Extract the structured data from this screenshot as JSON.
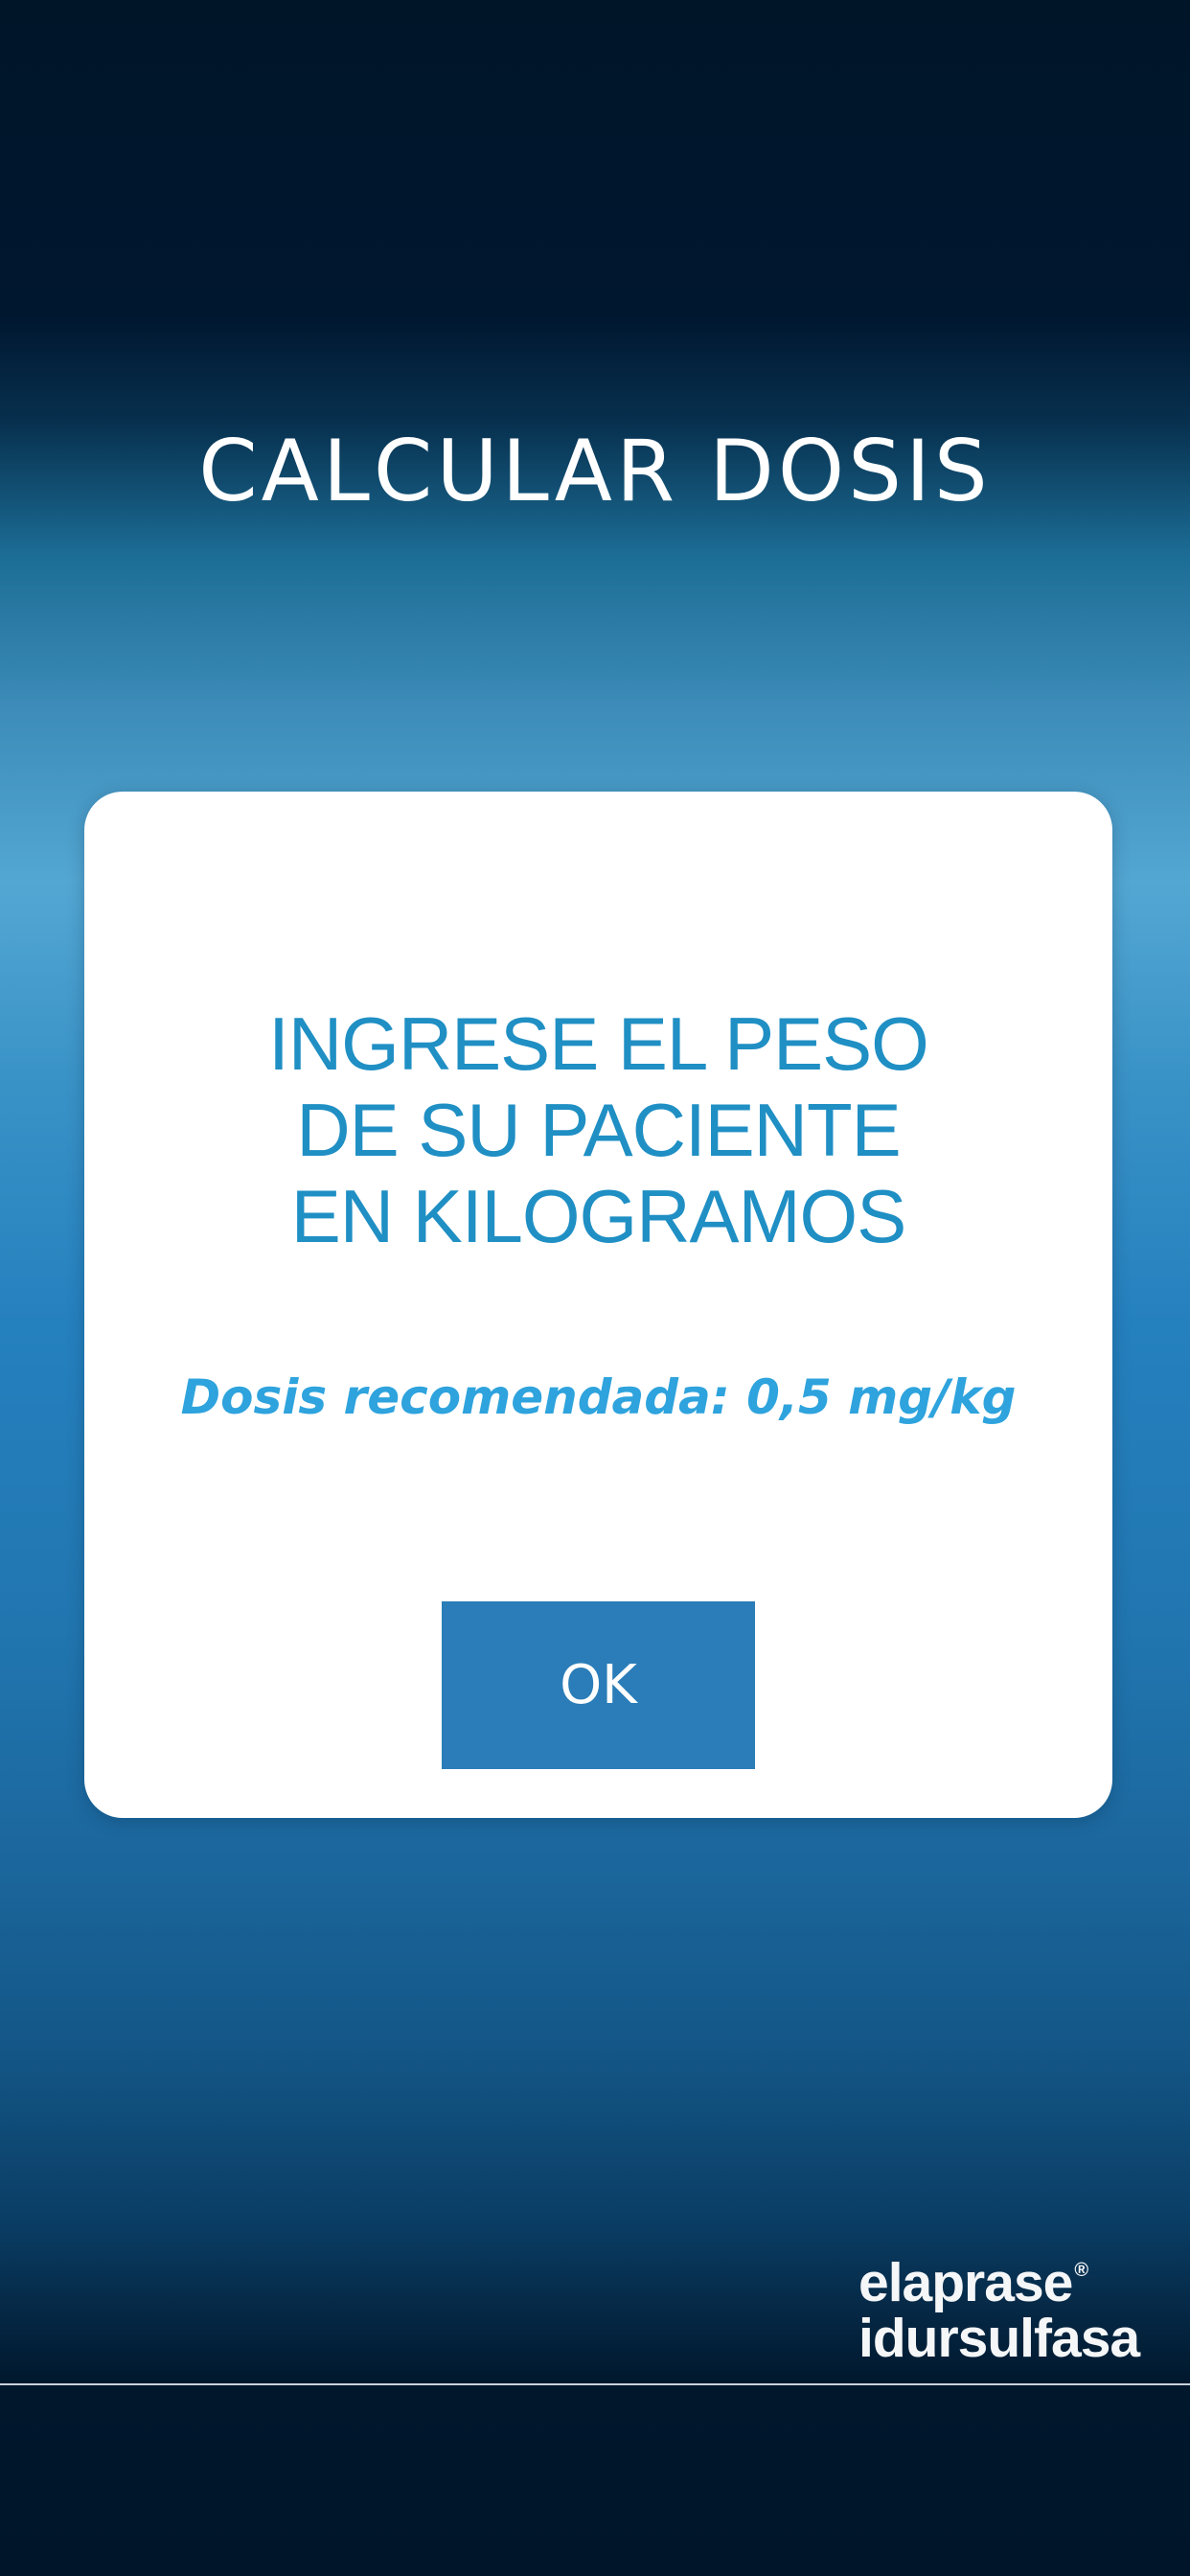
{
  "header": {
    "title": "CALCULAR DOSIS"
  },
  "dialog": {
    "message_lines": [
      "INGRESE EL PESO",
      "DE SU PACIENTE",
      "EN KILOGRAMOS"
    ],
    "recommended_dose": "Dosis recomendada: 0,5 mg/kg",
    "ok_label": "OK"
  },
  "brand": {
    "name_line": "elaprase",
    "registered_mark": "®",
    "generic_line": "idursulfasa"
  },
  "colors": {
    "dialog_text": "#1f8fc4",
    "dose_text": "#2ea3dd",
    "button": "#2a7db8",
    "background_top": "#001730",
    "background_mid": "#53a7d3"
  }
}
